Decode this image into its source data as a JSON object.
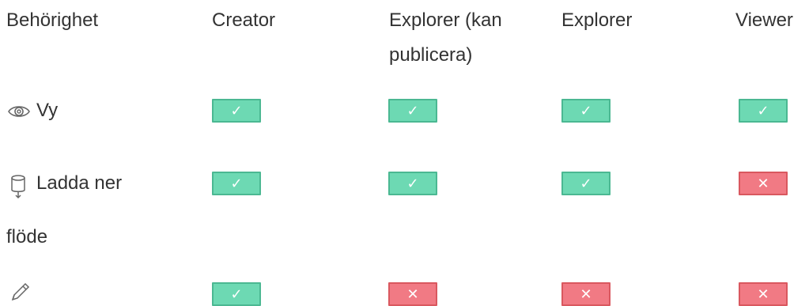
{
  "headers": {
    "permission": "Behörighet",
    "creator": "Creator",
    "explorer_publish_line1": "Explorer (kan",
    "explorer_publish_line2": "publicera)",
    "explorer": "Explorer",
    "viewer": "Viewer"
  },
  "rows": [
    {
      "label": "Vy",
      "icon": "eye-icon",
      "values": {
        "creator": "✓",
        "explorer_publish": "✓",
        "explorer": "✓",
        "viewer": "✓"
      }
    },
    {
      "label_line1": "Ladda ner",
      "label_line2": "flöde",
      "icon": "database-download-icon",
      "values": {
        "creator": "✓",
        "explorer_publish": "✓",
        "explorer": "✓",
        "viewer": "✕"
      }
    },
    {
      "label": "",
      "icon": "pencil-icon",
      "values": {
        "creator": "✓",
        "explorer_publish": "✕",
        "explorer": "✕",
        "viewer": "✕"
      }
    }
  ],
  "colors": {
    "allowed": "#6dd9b3",
    "denied": "#f17a84",
    "text": "#333333"
  }
}
